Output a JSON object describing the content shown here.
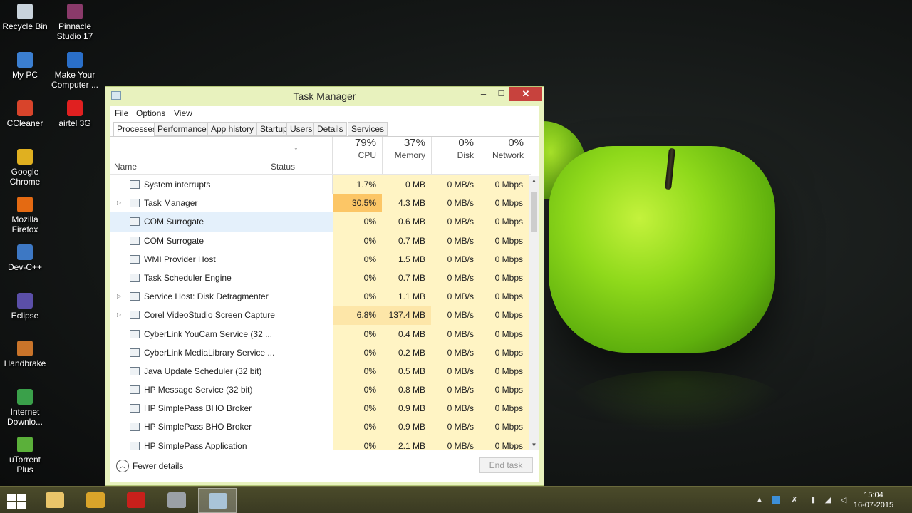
{
  "desktop": {
    "icons": [
      {
        "label": "Recycle Bin",
        "color": "#c9d3dc"
      },
      {
        "label": "Pinnacle Studio 17",
        "color": "#8a3a6a"
      },
      {
        "label": "My PC",
        "color": "#3b7fd1"
      },
      {
        "label": "Make Your Computer ...",
        "color": "#2a6fc9"
      },
      {
        "label": "CCleaner",
        "color": "#d8442b"
      },
      {
        "label": "airtel 3G",
        "color": "#e02020"
      },
      {
        "label": "Google Chrome",
        "color": "#e0b020"
      },
      {
        "label": "Mozilla Firefox",
        "color": "#e46a12"
      },
      {
        "label": "Dev-C++",
        "color": "#3d78c4"
      },
      {
        "label": "Eclipse",
        "color": "#5b4fa8"
      },
      {
        "label": "Handbrake",
        "color": "#c9742a"
      },
      {
        "label": "Internet Downlo...",
        "color": "#3aa04a"
      },
      {
        "label": "uTorrent Plus",
        "color": "#5bb03a"
      }
    ]
  },
  "window": {
    "title": "Task Manager",
    "controls": {
      "minimize": "–",
      "maximize": "☐",
      "close": "✕"
    },
    "menu": [
      "File",
      "Options",
      "View"
    ],
    "tabs": [
      "Processes",
      "Performance",
      "App history",
      "Startup",
      "Users",
      "Details",
      "Services"
    ],
    "active_tab": "Processes",
    "headers": {
      "name": "Name",
      "status": "Status",
      "cpu_pct": "79%",
      "cpu": "CPU",
      "mem_pct": "37%",
      "mem": "Memory",
      "disk_pct": "0%",
      "disk": "Disk",
      "net_pct": "0%",
      "net": "Network",
      "sort_indicator": "⌄"
    },
    "processes": [
      {
        "name": "System interrupts",
        "cpu": "1.7%",
        "mem": "0 MB",
        "disk": "0 MB/s",
        "net": "0 Mbps",
        "expandable": false,
        "icon": "system-icon",
        "selected": false
      },
      {
        "name": "Task Manager",
        "cpu": "30.5%",
        "mem": "4.3 MB",
        "disk": "0 MB/s",
        "net": "0 Mbps",
        "expandable": true,
        "icon": "task-manager-icon",
        "selected": false
      },
      {
        "name": "COM Surrogate",
        "cpu": "0%",
        "mem": "0.6 MB",
        "disk": "0 MB/s",
        "net": "0 Mbps",
        "expandable": false,
        "icon": "window-icon",
        "selected": true
      },
      {
        "name": "COM Surrogate",
        "cpu": "0%",
        "mem": "0.7 MB",
        "disk": "0 MB/s",
        "net": "0 Mbps",
        "expandable": false,
        "icon": "window-icon",
        "selected": false
      },
      {
        "name": "WMI Provider Host",
        "cpu": "0%",
        "mem": "1.5 MB",
        "disk": "0 MB/s",
        "net": "0 Mbps",
        "expandable": false,
        "icon": "wmi-icon",
        "selected": false
      },
      {
        "name": "Task Scheduler Engine",
        "cpu": "0%",
        "mem": "0.7 MB",
        "disk": "0 MB/s",
        "net": "0 Mbps",
        "expandable": false,
        "icon": "window-icon",
        "selected": false
      },
      {
        "name": "Service Host: Disk Defragmenter",
        "cpu": "0%",
        "mem": "1.1 MB",
        "disk": "0 MB/s",
        "net": "0 Mbps",
        "expandable": true,
        "icon": "gear-icon",
        "selected": false
      },
      {
        "name": "Corel VideoStudio Screen Capture",
        "cpu": "6.8%",
        "mem": "137.4 MB",
        "disk": "0 MB/s",
        "net": "0 Mbps",
        "expandable": true,
        "icon": "capture-icon",
        "selected": false
      },
      {
        "name": "CyberLink YouCam Service (32 ...",
        "cpu": "0%",
        "mem": "0.4 MB",
        "disk": "0 MB/s",
        "net": "0 Mbps",
        "expandable": false,
        "icon": "camera-icon",
        "selected": false
      },
      {
        "name": "CyberLink MediaLibrary Service ...",
        "cpu": "0%",
        "mem": "0.2 MB",
        "disk": "0 MB/s",
        "net": "0 Mbps",
        "expandable": false,
        "icon": "window-icon",
        "selected": false
      },
      {
        "name": "Java Update Scheduler (32 bit)",
        "cpu": "0%",
        "mem": "0.5 MB",
        "disk": "0 MB/s",
        "net": "0 Mbps",
        "expandable": false,
        "icon": "java-icon",
        "selected": false
      },
      {
        "name": "HP Message Service (32 bit)",
        "cpu": "0%",
        "mem": "0.8 MB",
        "disk": "0 MB/s",
        "net": "0 Mbps",
        "expandable": false,
        "icon": "hp-icon",
        "selected": false
      },
      {
        "name": "HP SimplePass BHO Broker",
        "cpu": "0%",
        "mem": "0.9 MB",
        "disk": "0 MB/s",
        "net": "0 Mbps",
        "expandable": false,
        "icon": "simplepass-icon",
        "selected": false
      },
      {
        "name": "HP SimplePass BHO Broker",
        "cpu": "0%",
        "mem": "0.9 MB",
        "disk": "0 MB/s",
        "net": "0 Mbps",
        "expandable": false,
        "icon": "simplepass-icon",
        "selected": false
      },
      {
        "name": "HP SimplePass Application",
        "cpu": "0%",
        "mem": "2.1 MB",
        "disk": "0 MB/s",
        "net": "0 Mbps",
        "expandable": false,
        "icon": "simplepass-icon",
        "selected": false
      }
    ],
    "footer": {
      "fewer_details": "Fewer details",
      "end_task": "End task"
    }
  },
  "taskbar": {
    "apps": [
      {
        "name": "file-explorer-icon",
        "color": "#e9c56a",
        "active": false
      },
      {
        "name": "chrome-icon",
        "color": "#d9a42a",
        "active": false
      },
      {
        "name": "adobe-reader-icon",
        "color": "#c8201b",
        "active": false
      },
      {
        "name": "screen-capture-icon",
        "color": "#9aa0a6",
        "active": false
      },
      {
        "name": "task-manager-icon",
        "color": "#a9c4d8",
        "active": true
      }
    ],
    "clock": {
      "time": "15:04",
      "date": "16-07-2015"
    }
  },
  "colors": {
    "heat_high": "#fcc666",
    "heat_mid": "#fde6a8",
    "heat_low": "#fff4c4",
    "window_frame": "#e8f2be",
    "close_red": "#c7423d"
  }
}
